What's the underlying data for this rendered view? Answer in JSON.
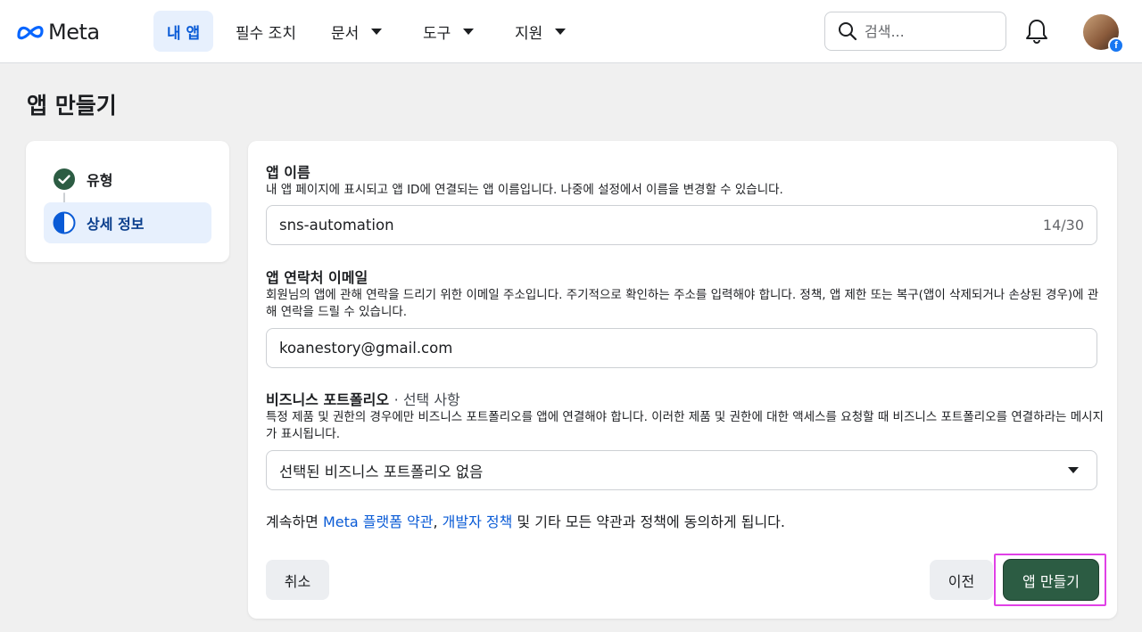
{
  "header": {
    "brand": "Meta",
    "nav": [
      {
        "label": "내 앱",
        "active": true
      },
      {
        "label": "필수 조치",
        "active": false
      },
      {
        "label": "문서",
        "active": false,
        "dropdown": true
      },
      {
        "label": "도구",
        "active": false,
        "dropdown": true
      },
      {
        "label": "지원",
        "active": false,
        "dropdown": true
      }
    ],
    "search_placeholder": "검색...",
    "icons": [
      "search-icon",
      "bell-icon",
      "avatar",
      "facebook-badge-icon"
    ]
  },
  "page": {
    "title": "앱 만들기"
  },
  "steps": [
    {
      "label": "유형",
      "status": "complete",
      "icon": "check-circle-icon"
    },
    {
      "label": "상세 정보",
      "status": "current",
      "icon": "half-circle-icon"
    }
  ],
  "form": {
    "app_name": {
      "label": "앱 이름",
      "description": "내 앱 페이지에 표시되고 앱 ID에 연결되는 앱 이름입니다. 나중에 설정에서 이름을 변경할 수 있습니다.",
      "value": "sns-automation",
      "counter": "14/30"
    },
    "contact_email": {
      "label": "앱 연락처 이메일",
      "description": "회원님의 앱에 관해 연락을 드리기 위한 이메일 주소입니다. 주기적으로 확인하는 주소를 입력해야 합니다. 정책, 앱 제한 또는 복구(앱이 삭제되거나 손상된 경우)에 관해 연락을 드릴 수 있습니다.",
      "value": "koanestory@gmail.com"
    },
    "business_portfolio": {
      "label": "비즈니스 포트폴리오",
      "optional": "· 선택 사항",
      "description": "특정 제품 및 권한의 경우에만 비즈니스 포트폴리오를 앱에 연결해야 합니다. 이러한 제품 및 권한에 대한 액세스를 요청할 때 비즈니스 포트폴리오를 연결하라는 메시지가 표시됩니다.",
      "selected": "선택된 비즈니스 포트폴리오 없음"
    },
    "terms": {
      "prefix": "계속하면 ",
      "link1": "Meta 플랫폼 약관",
      "sep": ", ",
      "link2": "개발자 정책",
      "suffix": " 및 기타 모든 약관과 정책에 동의하게 됩니다."
    },
    "buttons": {
      "cancel": "취소",
      "previous": "이전",
      "create": "앱 만들기"
    }
  },
  "colors": {
    "accent_blue": "#0a5bd6",
    "primary_green": "#2c5c43",
    "highlight_magenta": "#e040e6"
  }
}
